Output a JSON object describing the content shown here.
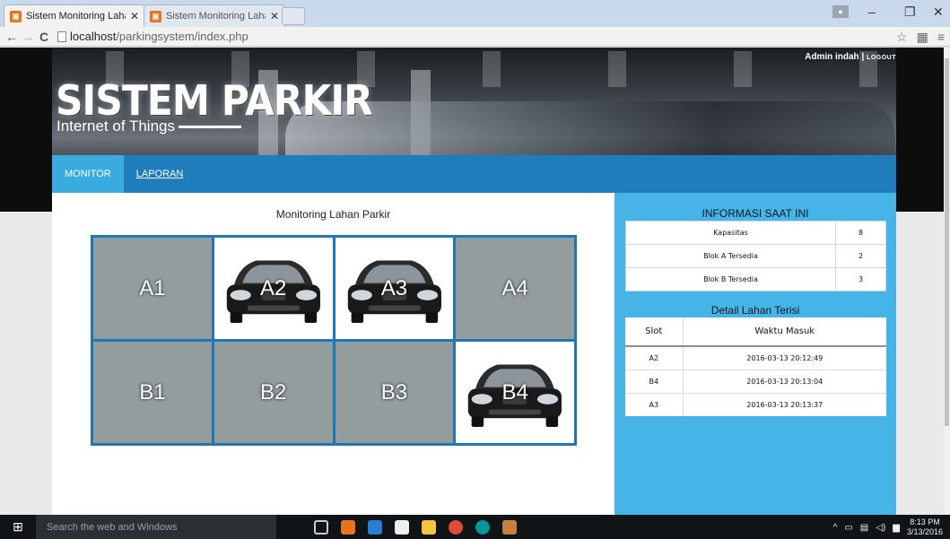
{
  "browser": {
    "tabs": [
      {
        "title": "Sistem Monitoring Lahan",
        "active": true
      },
      {
        "title": "Sistem Monitoring Lahan",
        "active": false
      }
    ],
    "url_host": "localhost",
    "url_path": "/parkingsystem/index.php"
  },
  "header": {
    "title": "SISTEM PARKIR",
    "subtitle": "Internet of Things",
    "user": "Admin indah",
    "separator": "|",
    "logout": "LOGOUT"
  },
  "nav": {
    "items": [
      {
        "label": "MONITOR",
        "active": true
      },
      {
        "label": "LAPORAN",
        "active": false
      }
    ]
  },
  "monitor": {
    "title": "Monitoring Lahan Parkir",
    "slots": [
      {
        "label": "A1",
        "occupied": false
      },
      {
        "label": "A2",
        "occupied": true
      },
      {
        "label": "A3",
        "occupied": true
      },
      {
        "label": "A4",
        "occupied": false
      },
      {
        "label": "B1",
        "occupied": false
      },
      {
        "label": "B2",
        "occupied": false
      },
      {
        "label": "B3",
        "occupied": false
      },
      {
        "label": "B4",
        "occupied": true
      }
    ],
    "free_color": "#939d9e",
    "border_color": "#2176b5"
  },
  "info": {
    "title": "INFORMASI SAAT INI",
    "rows": [
      {
        "label": "Kapasitas",
        "value": "8"
      },
      {
        "label": "Blok A Tersedia",
        "value": "2"
      },
      {
        "label": "Blok B Tersedia",
        "value": "3"
      }
    ]
  },
  "detail": {
    "title": "Detail Lahan Terisi",
    "headers": [
      "Slot",
      "Waktu Masuk"
    ],
    "rows": [
      {
        "slot": "A2",
        "time": "2016-03-13 20:12:49"
      },
      {
        "slot": "B4",
        "time": "2016-03-13 20:13:04"
      },
      {
        "slot": "A3",
        "time": "2016-03-13 20:13:37"
      }
    ]
  },
  "taskbar": {
    "search_placeholder": "Search the web and Windows",
    "time": "8:13 PM",
    "date": "3/13/2016"
  },
  "colors": {
    "navbar": "#1f7dbb",
    "nav_active": "#3aabdf",
    "sidebar": "#46b4e6"
  }
}
